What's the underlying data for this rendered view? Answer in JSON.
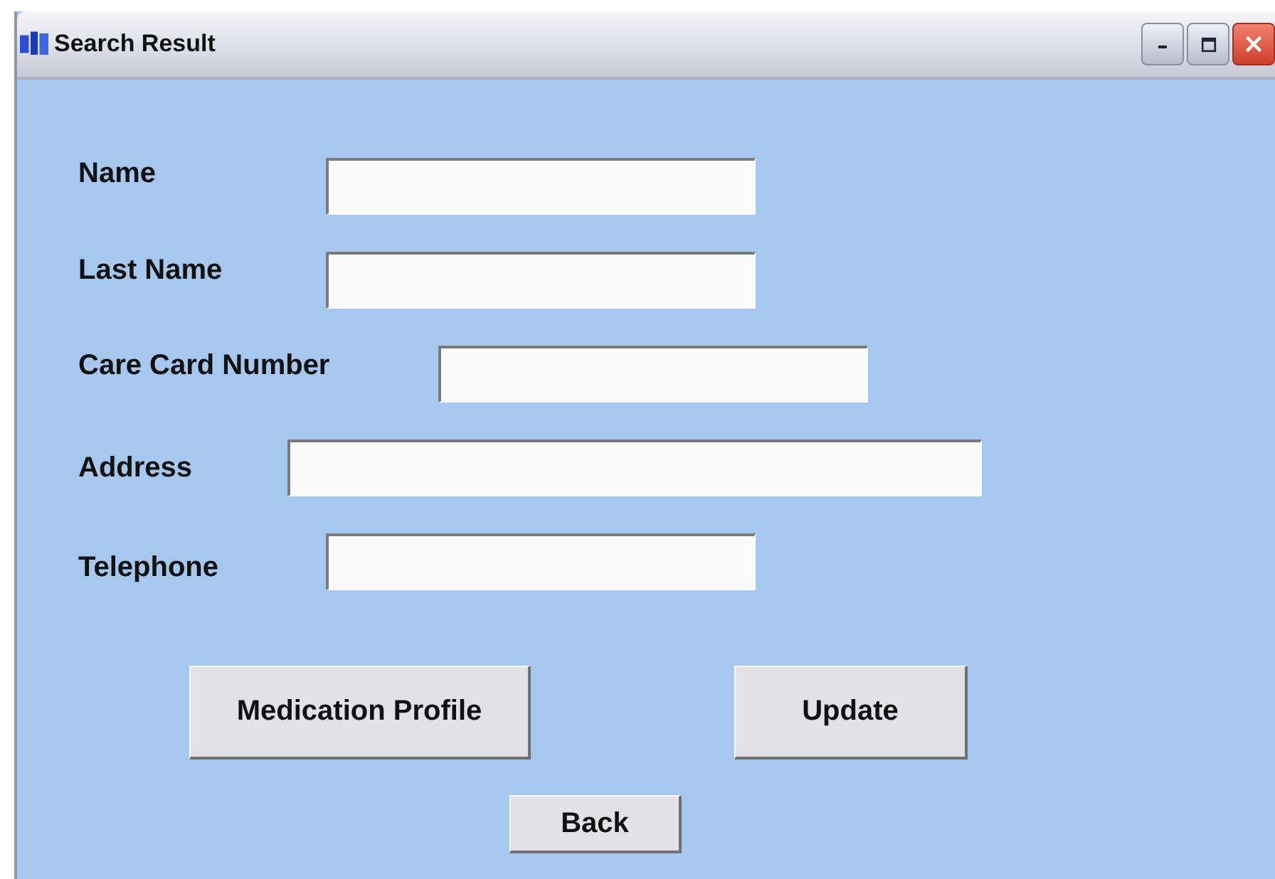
{
  "window": {
    "title": "Search Result"
  },
  "fields": [
    {
      "label": "Name"
    },
    {
      "label": "Last Name"
    },
    {
      "label": "Care Card Number"
    },
    {
      "label": "Address"
    },
    {
      "label": "Telephone"
    }
  ],
  "buttons": [
    "Medication Profile",
    "Update",
    "Back"
  ]
}
